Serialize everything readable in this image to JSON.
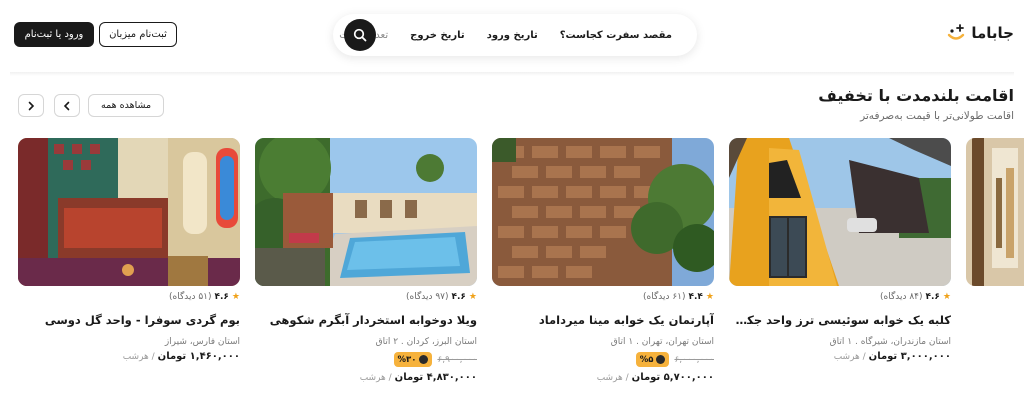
{
  "header": {
    "logo_text": "جاباما",
    "search": {
      "destination": "مقصد سفرت کجاست؟",
      "checkin": "تاریخ ورود",
      "checkout": "تاریخ خروج",
      "guests": "تعداد نفرات"
    },
    "host_signup": "ثبت‌نام میزبان",
    "login": "ورود یا ثبت‌نام"
  },
  "section": {
    "title": "اقامت بلندمدت با تخفیف",
    "subtitle": "اقامت طولانی‌تر با قیمت به‌صرفه‌تر",
    "view_all": "مشاهده همه"
  },
  "per_night": "/ هرشب",
  "currency": "تومان",
  "cards": [
    {
      "rating": "۴.۶",
      "reviews": "(۸۴ دیدگاه)",
      "title": "کلبه یک خوابه سوئیسی ترز واحد جکوزی دار...",
      "location": "استان مازندران، شیرگاه . ۱ اتاق",
      "price": "۳,۰۰۰,۰۰۰ تومان",
      "old_price": "",
      "discount": ""
    },
    {
      "rating": "۴.۴",
      "reviews": "(۶۱ دیدگاه)",
      "title": "آپارتمان یک خوابه مینا میرداماد",
      "location": "استان تهران، تهران . ۱ اتاق",
      "price": "۵,۷۰۰,۰۰۰ تومان",
      "old_price": "۶,۰۰۰,۰۰۰",
      "discount": "%۵"
    },
    {
      "rating": "۴.۶",
      "reviews": "(۹۷ دیدگاه)",
      "title": "ویلا دوخوابه استخردار آبگرم شکوهی",
      "location": "استان البرز، کردان . ۲ اتاق",
      "price": "۴,۸۳۰,۰۰۰ تومان",
      "old_price": "۶,۹۰۰,۰۰۰",
      "discount": "%۳۰"
    },
    {
      "rating": "۴.۶",
      "reviews": "(۵۱ دیدگاه)",
      "title": "بوم گردی سوفرا - واحد گل دوسی",
      "location": "استان فارس، شیراز",
      "price": "۱,۴۶۰,۰۰۰ تومان",
      "old_price": "",
      "discount": ""
    }
  ],
  "icons": {
    "search": "search-icon",
    "star": "star-icon",
    "chevron_left": "chevron-left-icon",
    "chevron_right": "chevron-right-icon"
  },
  "colors": {
    "dark": "#1a1a1a",
    "discount": "#f6b23c",
    "star": "#f0a21a"
  }
}
